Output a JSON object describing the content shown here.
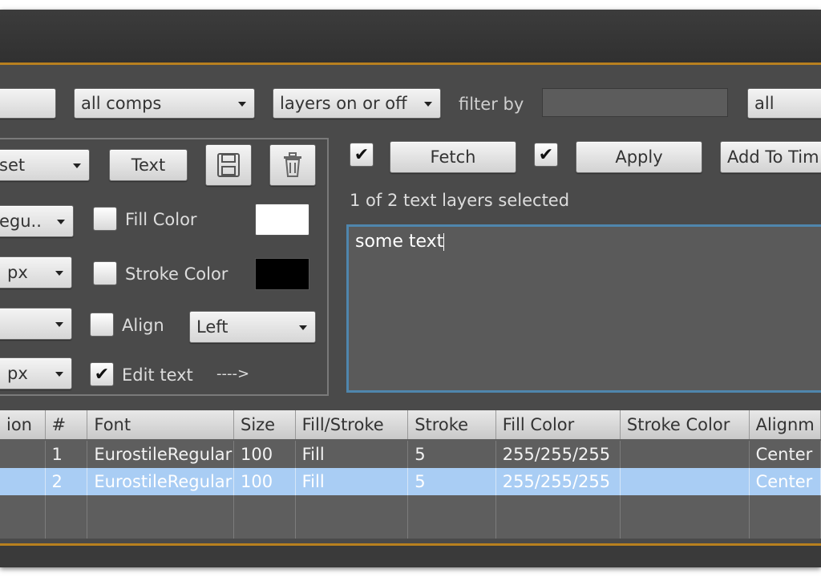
{
  "toolbar": {
    "partial_select_1": "",
    "comps_select": "all comps",
    "layers_select": "layers on or off",
    "filter_label": "filter by",
    "filter_value": "",
    "all_select": "all"
  },
  "left_panel": {
    "preset_select": "set",
    "text_button": "Text",
    "font_select": "egu..",
    "fill_color_label": "Fill Color",
    "size_unit_select": "px",
    "stroke_color_label": "Stroke Color",
    "third_select": "",
    "align_label": "Align",
    "align_select": "Left",
    "stroke_unit_select": "px",
    "edit_text_label": "Edit text",
    "arrow_text": "---->",
    "fill_color_value": "#ffffff",
    "stroke_color_value": "#000000",
    "edit_text_checked": "✔"
  },
  "right_panel": {
    "fetch_checked": "✔",
    "fetch_button": "Fetch",
    "apply_checked": "✔",
    "apply_button": "Apply",
    "add_button": "Add To Tim",
    "status": "1 of 2 text layers selected",
    "text_content": "some text"
  },
  "table": {
    "headers": [
      "ion",
      "#",
      "Font",
      "Size",
      "Fill/Stroke",
      "Stroke",
      "Fill Color",
      "Stroke Color",
      "Alignm"
    ],
    "rows": [
      [
        "",
        "1",
        "EurostileRegular",
        "100",
        "Fill",
        "5",
        "255/255/255",
        "",
        "Center"
      ],
      [
        "",
        "2",
        "EurostileRegular",
        "100",
        "Fill",
        "5",
        "255/255/255",
        "",
        "Center"
      ]
    ],
    "selected_row_color": "#a9cdf4"
  },
  "colors": {
    "accent_orange": "#b8801f",
    "focus_blue": "#4f86ad",
    "panel_bg": "#4a4a4a"
  }
}
